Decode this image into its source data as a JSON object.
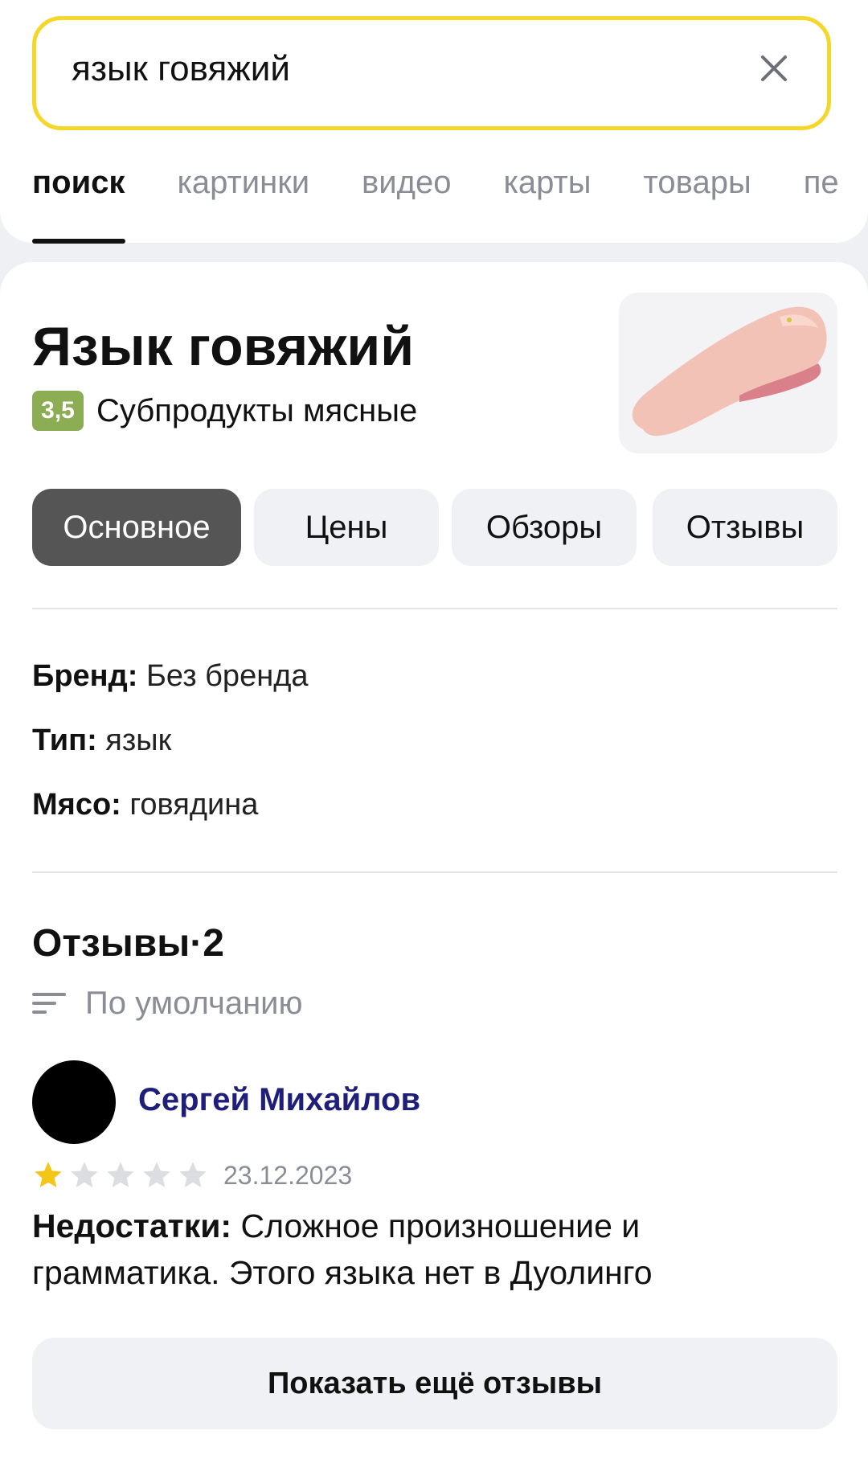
{
  "search": {
    "query": "язык говяжий",
    "clear_icon": "close-icon"
  },
  "nav": {
    "tabs": [
      {
        "label": "поиск",
        "active": true
      },
      {
        "label": "картинки",
        "active": false
      },
      {
        "label": "видео",
        "active": false
      },
      {
        "label": "карты",
        "active": false
      },
      {
        "label": "товары",
        "active": false
      },
      {
        "label": "пе",
        "active": false
      }
    ]
  },
  "product": {
    "title": "Язык говяжий",
    "rating": "3,5",
    "category": "Субпродукты мясные",
    "image_icon": "beef-tongue-image"
  },
  "section_tabs": [
    {
      "label": "Основное",
      "active": true
    },
    {
      "label": "Цены",
      "active": false
    },
    {
      "label": "Обзоры",
      "active": false
    },
    {
      "label": "Отзывы",
      "active": false
    }
  ],
  "specs": [
    {
      "key": "Бренд:",
      "value": "Без бренда"
    },
    {
      "key": "Тип:",
      "value": "язык"
    },
    {
      "key": "Мясо:",
      "value": "говядина"
    }
  ],
  "reviews": {
    "title": "Отзывы",
    "separator": "·",
    "count": "2",
    "sort_label": "По умолчанию",
    "sort_icon": "sort-lines-icon",
    "items": [
      {
        "author": "Сергей Михайлов",
        "stars": 1,
        "max_stars": 5,
        "date": "23.12.2023",
        "label": "Недостатки:",
        "text": "Сложное произношение и грамматика. Этого языка нет в Дуолинго"
      }
    ],
    "more_button": "Показать ещё отзывы"
  },
  "colors": {
    "search_border": "#f5d62b",
    "rating_badge": "#8cad53",
    "active_tab": "#555555",
    "reviewer_name": "#1f1f7a",
    "star_filled": "#f5c518",
    "star_empty": "#dcdde0"
  }
}
